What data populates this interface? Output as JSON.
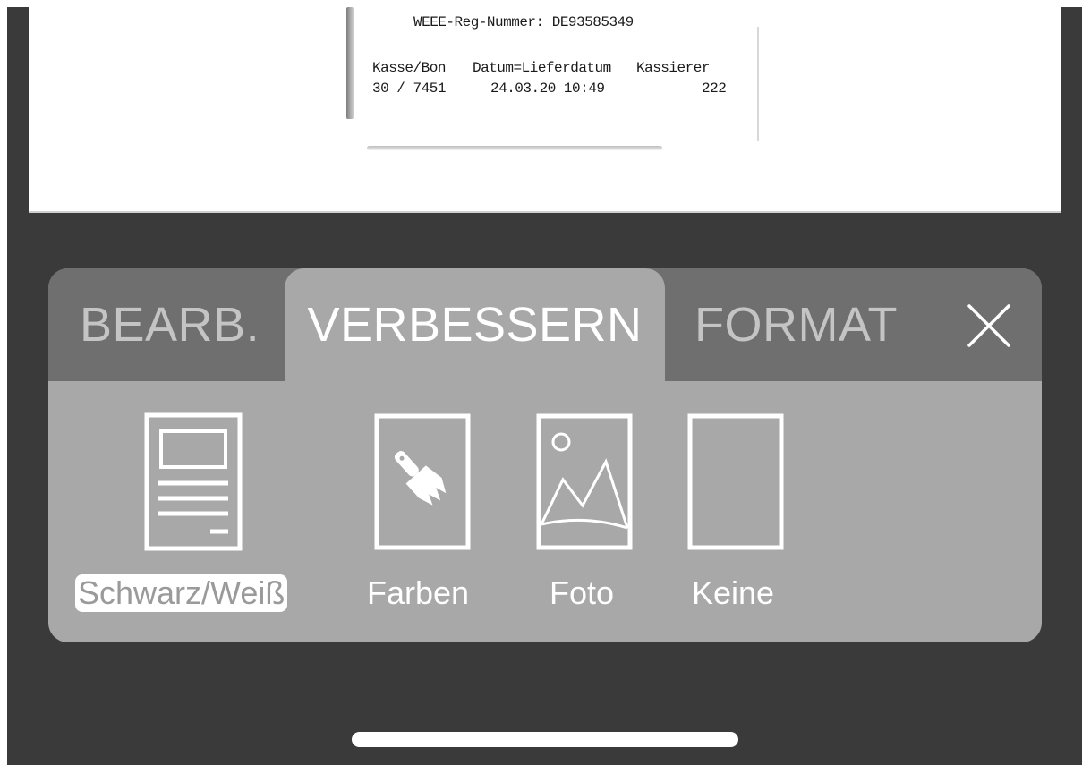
{
  "receipt": {
    "line1": "WEEE-Reg-Nummer: DE93585349",
    "col_headers": [
      "Kasse/Bon",
      "Datum=Lieferdatum",
      "Kassierer"
    ],
    "col_values": [
      "30 / 7451",
      "24.03.20 10:49",
      "222"
    ]
  },
  "tabs": [
    {
      "label": "BEARB.",
      "active": false
    },
    {
      "label": "VERBESSERN",
      "active": true
    },
    {
      "label": "FORMAT",
      "active": false
    }
  ],
  "close": {
    "icon": "close-icon"
  },
  "filters": [
    {
      "label": "Schwarz/Weiß",
      "icon": "document-text-icon",
      "selected": true
    },
    {
      "label": "Farben",
      "icon": "paintbrush-icon",
      "selected": false
    },
    {
      "label": "Foto",
      "icon": "photo-icon",
      "selected": false
    },
    {
      "label": "Keine",
      "icon": "blank-page-icon",
      "selected": false
    }
  ],
  "colors": {
    "background": "#3a3a3a",
    "panel": "#a8a8a8",
    "tabbar": "#6f6f6f",
    "active_tab_text": "#ffffff",
    "inactive_tab_text": "#c4c4c4"
  }
}
